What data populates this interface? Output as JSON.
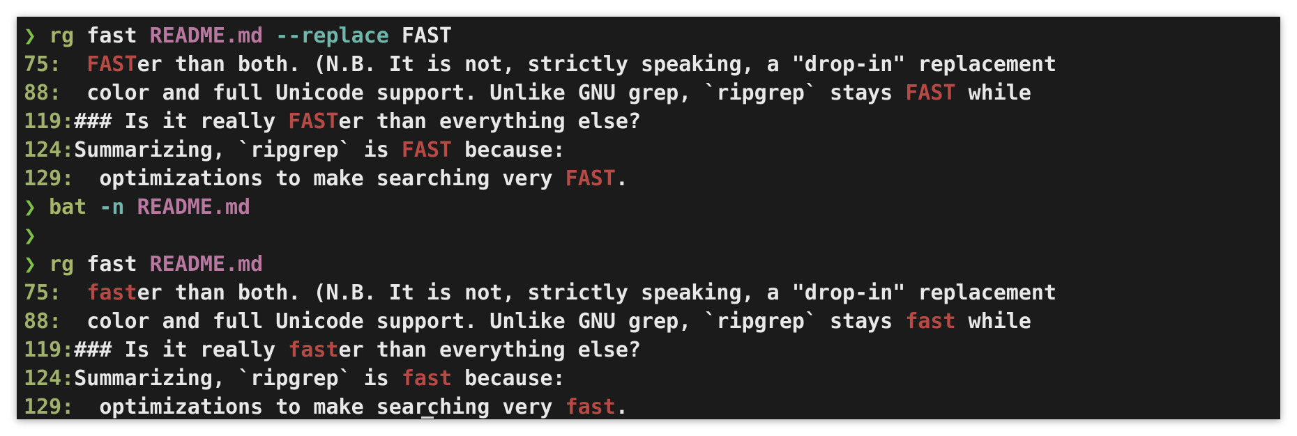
{
  "colors": {
    "background": "#1b1b1b",
    "prompt": "#7fbf48",
    "command": "#a5b66a",
    "argument": "#e8e8e8",
    "path": "#b9789f",
    "flag": "#6fb7ad",
    "line_number": "#9fb16a",
    "match": "#b74a45"
  },
  "terminal": {
    "lines": [
      {
        "kind": "prompt",
        "segments": [
          {
            "text": "❯ ",
            "role": "prompt"
          },
          {
            "text": "rg",
            "role": "cmd"
          },
          {
            "text": " fast ",
            "role": "plain"
          },
          {
            "text": "README.md",
            "role": "path"
          },
          {
            "text": " --replace",
            "role": "flag"
          },
          {
            "text": " FAST",
            "role": "plain"
          }
        ]
      },
      {
        "kind": "output",
        "segments": [
          {
            "text": "75:",
            "role": "lineno"
          },
          {
            "text": "  ",
            "role": "plain"
          },
          {
            "text": "FAST",
            "role": "match"
          },
          {
            "text": "er than both. (N.B. It is not, strictly speaking, a \"drop-in\" replacement",
            "role": "plain"
          }
        ]
      },
      {
        "kind": "output",
        "segments": [
          {
            "text": "88:",
            "role": "lineno"
          },
          {
            "text": "  color and full Unicode support. Unlike GNU grep, `ripgrep` stays ",
            "role": "plain"
          },
          {
            "text": "FAST",
            "role": "match"
          },
          {
            "text": " while",
            "role": "plain"
          }
        ]
      },
      {
        "kind": "output",
        "segments": [
          {
            "text": "119:",
            "role": "lineno"
          },
          {
            "text": "### Is it really ",
            "role": "plain"
          },
          {
            "text": "FAST",
            "role": "match"
          },
          {
            "text": "er than everything else?",
            "role": "plain"
          }
        ]
      },
      {
        "kind": "output",
        "segments": [
          {
            "text": "124:",
            "role": "lineno"
          },
          {
            "text": "Summarizing, `ripgrep` is ",
            "role": "plain"
          },
          {
            "text": "FAST",
            "role": "match"
          },
          {
            "text": " because:",
            "role": "plain"
          }
        ]
      },
      {
        "kind": "output",
        "segments": [
          {
            "text": "129:",
            "role": "lineno"
          },
          {
            "text": "  optimizations to make searching very ",
            "role": "plain"
          },
          {
            "text": "FAST",
            "role": "match"
          },
          {
            "text": ".",
            "role": "plain"
          }
        ]
      },
      {
        "kind": "prompt",
        "segments": [
          {
            "text": "❯ ",
            "role": "prompt"
          },
          {
            "text": "bat",
            "role": "cmd"
          },
          {
            "text": " -n",
            "role": "flag"
          },
          {
            "text": " ",
            "role": "plain"
          },
          {
            "text": "README.md",
            "role": "path"
          }
        ]
      },
      {
        "kind": "prompt",
        "segments": [
          {
            "text": "❯",
            "role": "prompt"
          }
        ]
      },
      {
        "kind": "prompt",
        "segments": [
          {
            "text": "❯ ",
            "role": "prompt"
          },
          {
            "text": "rg",
            "role": "cmd"
          },
          {
            "text": " fast ",
            "role": "plain"
          },
          {
            "text": "README.md",
            "role": "path"
          }
        ]
      },
      {
        "kind": "output",
        "segments": [
          {
            "text": "75:",
            "role": "lineno"
          },
          {
            "text": "  ",
            "role": "plain"
          },
          {
            "text": "fast",
            "role": "match"
          },
          {
            "text": "er than both. (N.B. It is not, strictly speaking, a \"drop-in\" replacement",
            "role": "plain"
          }
        ]
      },
      {
        "kind": "output",
        "segments": [
          {
            "text": "88:",
            "role": "lineno"
          },
          {
            "text": "  color and full Unicode support. Unlike GNU grep, `ripgrep` stays ",
            "role": "plain"
          },
          {
            "text": "fast",
            "role": "match"
          },
          {
            "text": " while",
            "role": "plain"
          }
        ]
      },
      {
        "kind": "output",
        "segments": [
          {
            "text": "119:",
            "role": "lineno"
          },
          {
            "text": "### Is it really ",
            "role": "plain"
          },
          {
            "text": "fast",
            "role": "match"
          },
          {
            "text": "er than everything else?",
            "role": "plain"
          }
        ]
      },
      {
        "kind": "output",
        "segments": [
          {
            "text": "124:",
            "role": "lineno"
          },
          {
            "text": "Summarizing, `ripgrep` is ",
            "role": "plain"
          },
          {
            "text": "fast",
            "role": "match"
          },
          {
            "text": " because:",
            "role": "plain"
          }
        ]
      },
      {
        "kind": "output",
        "segments": [
          {
            "text": "129:",
            "role": "lineno"
          },
          {
            "text": "  optimizations to make searching very ",
            "role": "plain"
          },
          {
            "text": "fast",
            "role": "match"
          },
          {
            "text": ".",
            "role": "plain"
          }
        ]
      }
    ]
  }
}
